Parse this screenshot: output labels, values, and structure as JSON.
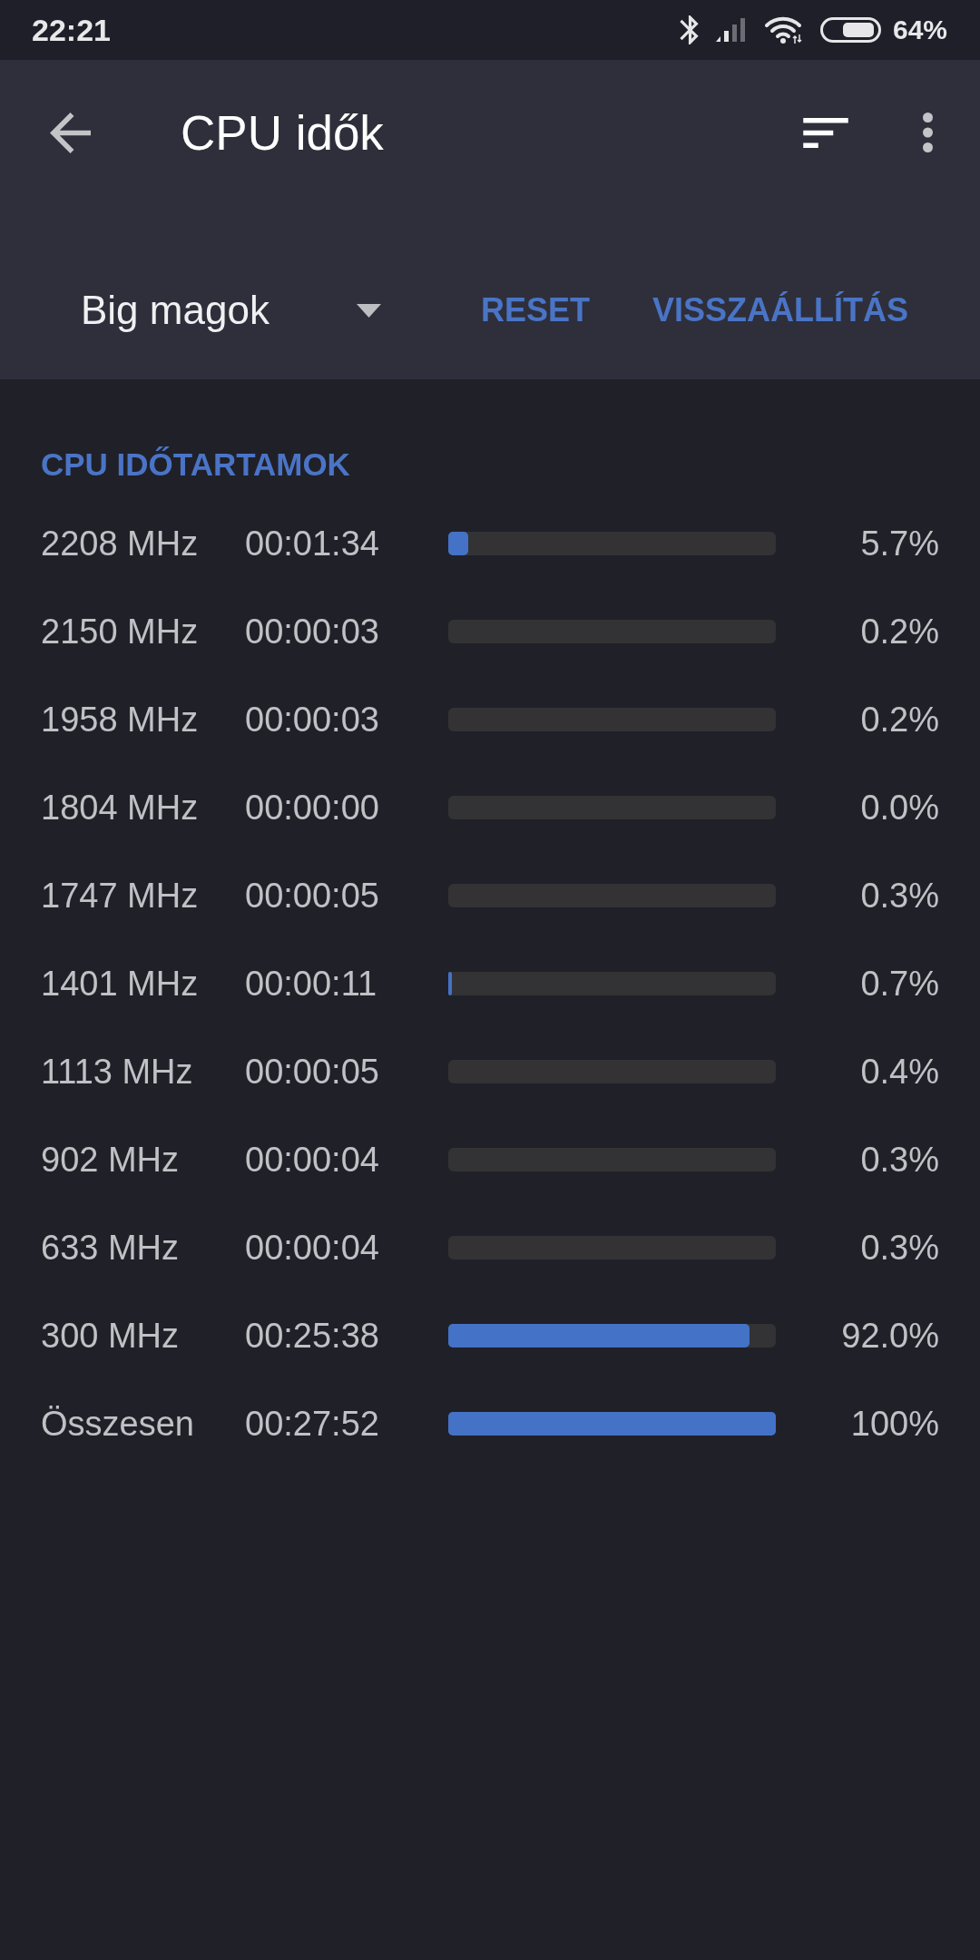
{
  "status_bar": {
    "time": "22:21",
    "battery": "64%"
  },
  "app_bar": {
    "title": "CPU idők",
    "dropdown": {
      "value": "Big magok"
    },
    "buttons": [
      "RESET",
      "VISSZAÁLLÍTÁS"
    ]
  },
  "section": {
    "title": "CPU IDŐTARTAMOK",
    "rows": [
      {
        "frequency": "2208 MHz",
        "time": "00:01:34",
        "level": 0.06,
        "percent": "5.7%"
      },
      {
        "frequency": "2150 MHz",
        "time": "00:00:03",
        "level": 0,
        "percent": "0.2%"
      },
      {
        "frequency": "1958 MHz",
        "time": "00:00:03",
        "level": 0,
        "percent": "0.2%"
      },
      {
        "frequency": "1804 MHz",
        "time": "00:00:00",
        "level": 0,
        "percent": "0.0%"
      },
      {
        "frequency": "1747 MHz",
        "time": "00:00:05",
        "level": 0,
        "percent": "0.3%"
      },
      {
        "frequency": "1401 MHz",
        "time": "00:00:11",
        "level": 0.01,
        "percent": "0.7%"
      },
      {
        "frequency": "1113 MHz",
        "time": "00:00:05",
        "level": 0,
        "percent": "0.4%"
      },
      {
        "frequency": "902 MHz",
        "time": "00:00:04",
        "level": 0,
        "percent": "0.3%"
      },
      {
        "frequency": "633 MHz",
        "time": "00:00:04",
        "level": 0,
        "percent": "0.3%"
      },
      {
        "frequency": "300 MHz",
        "time": "00:25:38",
        "level": 0.92,
        "percent": "92.0%"
      },
      {
        "frequency": "Összesen",
        "time": "00:27:52",
        "level": 1,
        "percent": "100%"
      }
    ]
  }
}
